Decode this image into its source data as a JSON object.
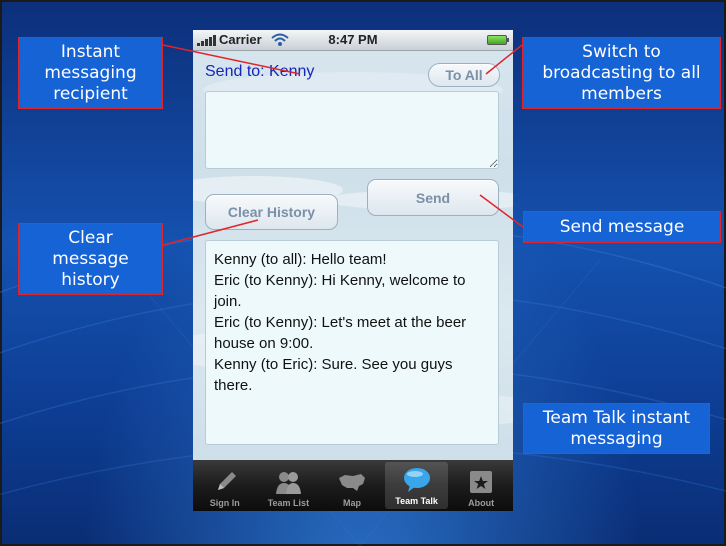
{
  "status_bar": {
    "carrier": "Carrier",
    "time": "8:47 PM"
  },
  "app": {
    "send_to": "Send to: Kenny",
    "to_all_label": "To All",
    "send_label": "Send",
    "clear_history_label": "Clear History",
    "compose_value": "",
    "history": [
      "Kenny (to all): Hello team!",
      "Eric (to Kenny): Hi Kenny, welcome to join.",
      "Eric (to Kenny): Let's meet at the beer house on 9:00.",
      "Kenny (to Eric): Sure. See you guys there."
    ]
  },
  "tabs": [
    {
      "label": "Sign In",
      "icon": "pencil-icon"
    },
    {
      "label": "Team List",
      "icon": "people-icon"
    },
    {
      "label": "Map",
      "icon": "map-icon"
    },
    {
      "label": "Team Talk",
      "icon": "speech-bubble-icon",
      "active": true
    },
    {
      "label": "About",
      "icon": "star-box-icon"
    }
  ],
  "callouts": {
    "recipient": "Instant\nmessaging\nrecipient",
    "broadcast": "Switch to\nbroadcasting to all\nmembers",
    "send": "Send message",
    "clear": "Clear\nmessage\nhistory",
    "teamtalk": "Team Talk instant\nmessaging"
  },
  "colors": {
    "callout_bg": "#1663d6",
    "callout_border": "#e0252a",
    "recipient_text": "#1626b6"
  }
}
